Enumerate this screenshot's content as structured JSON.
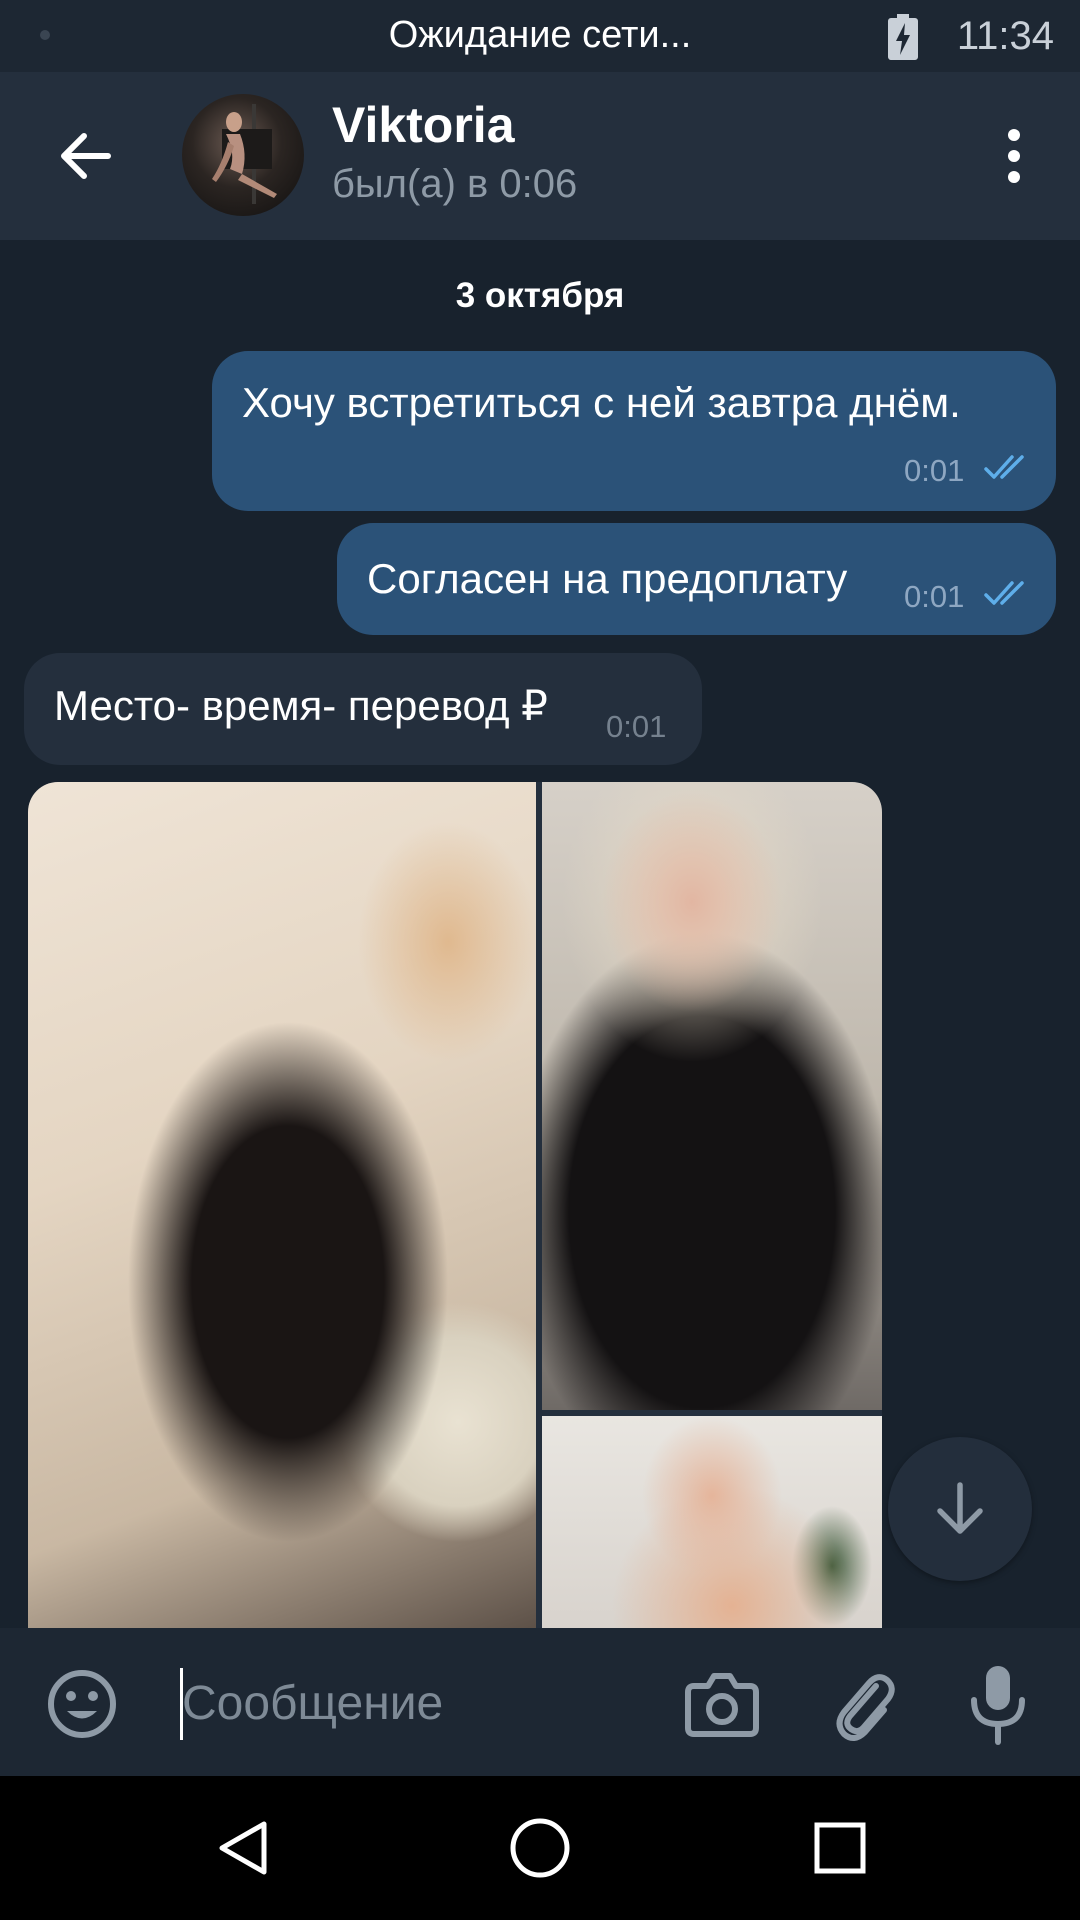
{
  "status_bar": {
    "network_text": "Ожидание сети...",
    "time": "11:34",
    "battery_icon": "battery-charging-icon"
  },
  "header": {
    "back_icon": "arrow-left-icon",
    "contact_name": "Viktoria",
    "contact_status": "был(а) в 0:06",
    "menu_icon": "more-vertical-icon"
  },
  "chat": {
    "date": "3 октября",
    "messages": [
      {
        "direction": "out",
        "text": "Хочу встретиться с ней завтра днём.",
        "time": "0:01",
        "status": "read"
      },
      {
        "direction": "out",
        "text": "Согласен на предоплату",
        "time": "0:01",
        "status": "read"
      },
      {
        "direction": "in",
        "text": "Место- время- перевод ₽",
        "time": "0:01"
      }
    ],
    "album": {
      "photo_count": 3
    },
    "scroll_down_icon": "arrow-down-icon"
  },
  "composer": {
    "placeholder": "Сообщение",
    "emoji_icon": "smile-icon",
    "camera_icon": "camera-icon",
    "attach_icon": "paperclip-icon",
    "mic_icon": "microphone-icon"
  },
  "navigation": {
    "back_icon": "nav-back-triangle-icon",
    "home_icon": "nav-home-circle-icon",
    "recents_icon": "nav-recents-square-icon"
  },
  "colors": {
    "background": "#18222d",
    "header": "#242f3d",
    "outgoing_bubble": "#2b5278",
    "incoming_bubble": "#242f3d",
    "read_ticks": "#5eaeea"
  }
}
